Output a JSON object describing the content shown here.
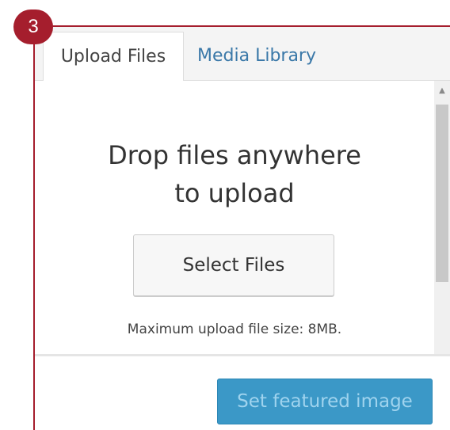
{
  "step_badge": "3",
  "tabs": [
    {
      "label": "Upload Files",
      "active": true
    },
    {
      "label": "Media Library",
      "active": false
    }
  ],
  "uploader": {
    "drop_line_1": "Drop files anywhere",
    "drop_line_2": "to upload",
    "select_button": "Select Files",
    "max_size_text": "Maximum upload file size: 8MB."
  },
  "footer": {
    "primary_button": "Set featured image"
  },
  "colors": {
    "accent_red": "#a51e2d",
    "primary_blue": "#3b98c7",
    "link_blue": "#3a78a8"
  },
  "icons": {
    "scroll_up": "triangle-up-icon",
    "scroll_down": "triangle-down-icon"
  }
}
